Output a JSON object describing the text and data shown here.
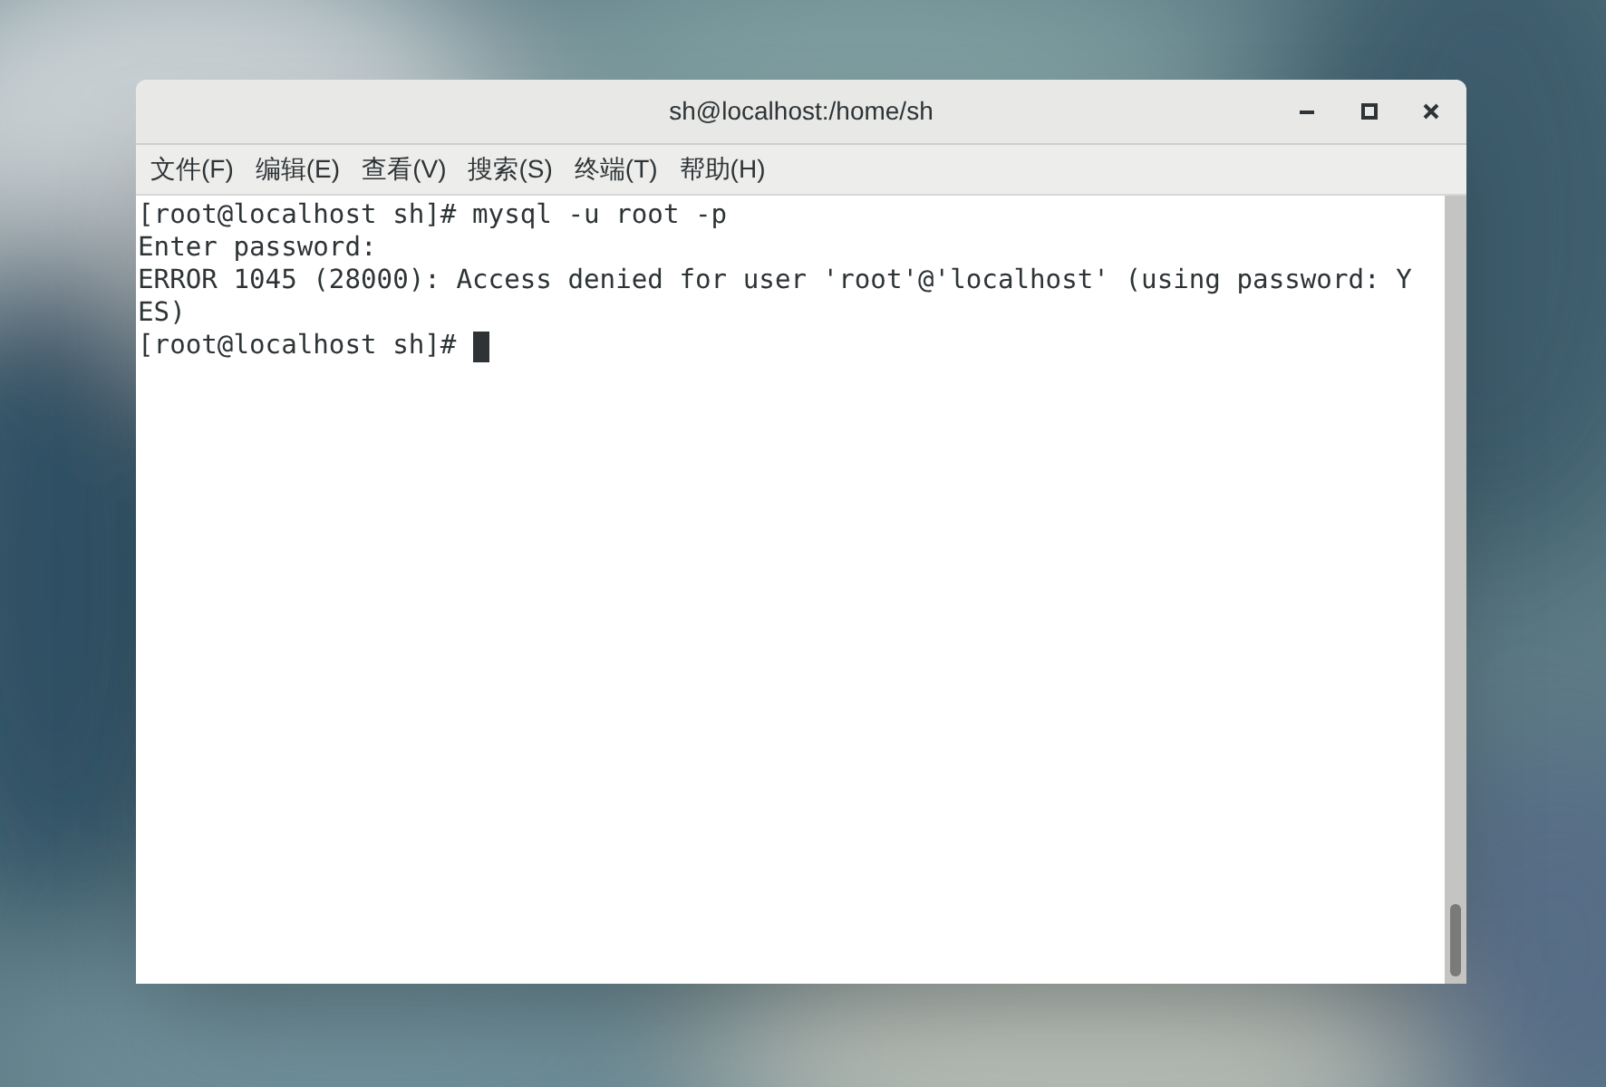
{
  "window": {
    "title": "sh@localhost:/home/sh"
  },
  "menu": [
    "文件(F)",
    "编辑(E)",
    "查看(V)",
    "搜索(S)",
    "终端(T)",
    "帮助(H)"
  ],
  "terminal": {
    "lines": [
      {
        "text": "[root@localhost sh]# mysql -u root -p",
        "cursor": false
      },
      {
        "text": "Enter password:",
        "cursor": false
      },
      {
        "text": "ERROR 1045 (28000): Access denied for user 'root'@'localhost' (using password: Y",
        "cursor": false
      },
      {
        "text": "ES)",
        "cursor": false
      },
      {
        "text": "[root@localhost sh]# ",
        "cursor": true
      }
    ]
  }
}
